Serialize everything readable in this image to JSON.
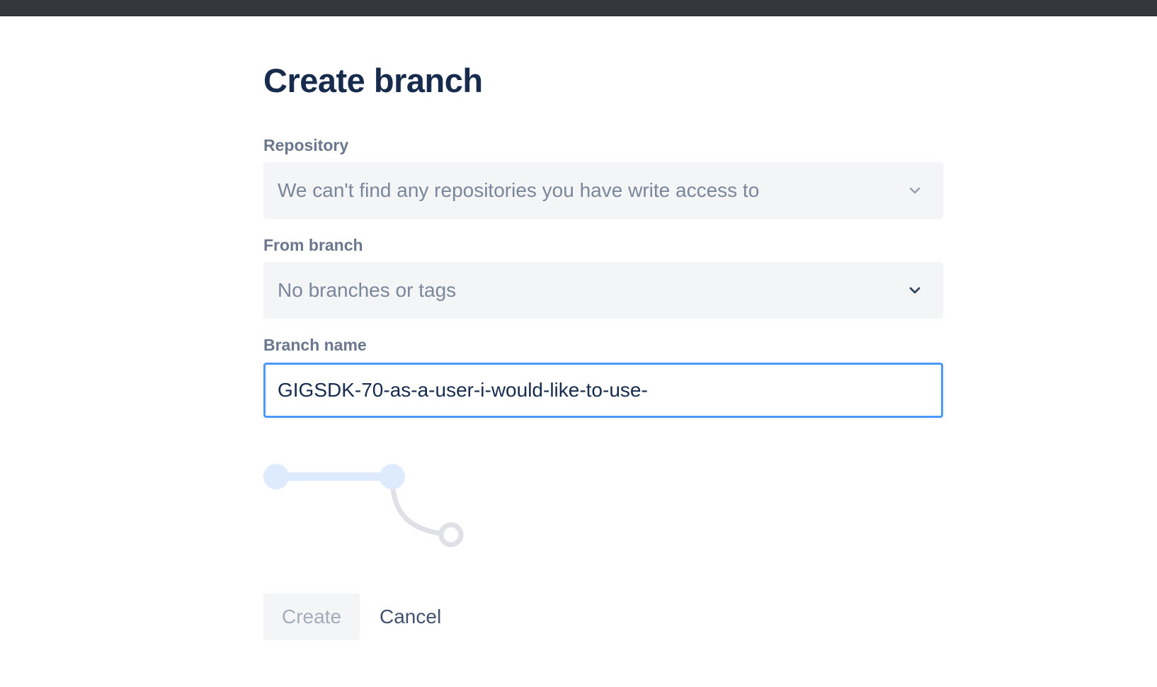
{
  "page": {
    "title": "Create branch"
  },
  "form": {
    "repository": {
      "label": "Repository",
      "value": "We can't find any repositories you have write access to",
      "icon": "chevron-down-icon"
    },
    "from_branch": {
      "label": "From branch",
      "value": "No branches or tags",
      "icon": "chevron-down-icon"
    },
    "branch_name": {
      "label": "Branch name",
      "value": "GIGSDK-70-as-a-user-i-would-like-to-use-"
    }
  },
  "actions": {
    "create_label": "Create",
    "cancel_label": "Cancel"
  },
  "colors": {
    "accent": "#4c9aff",
    "title": "#172b4d",
    "label": "#6b778c",
    "field_bg": "#f4f5f7"
  }
}
